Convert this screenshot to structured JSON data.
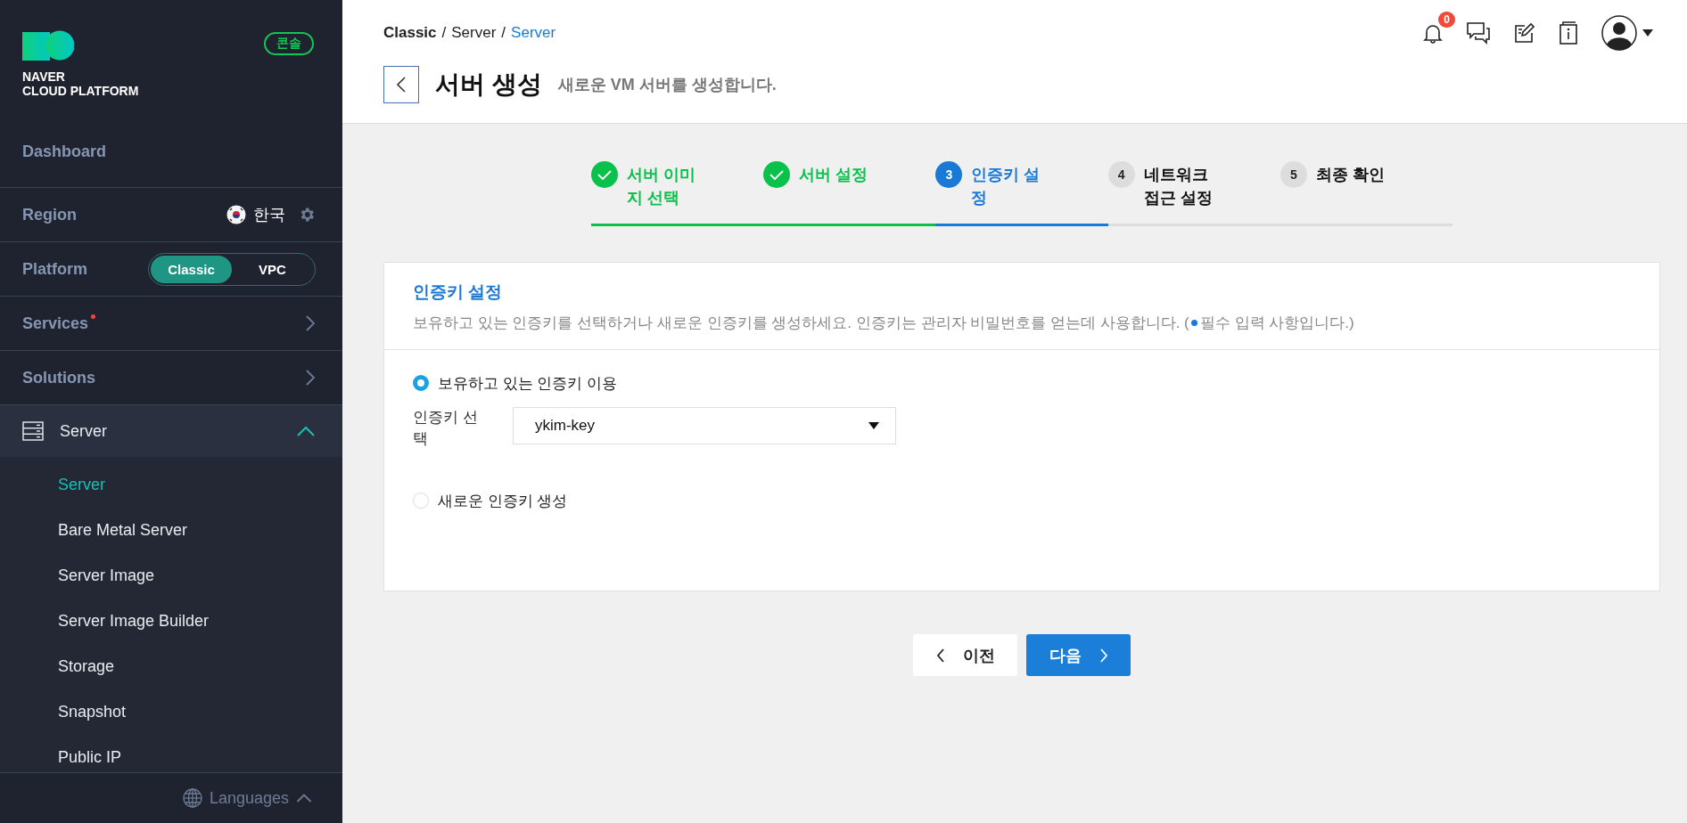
{
  "sidebar": {
    "logo": {
      "line1": "NAVER",
      "line2": "CLOUD PLATFORM"
    },
    "console_badge": "콘솔",
    "items": [
      {
        "kind": "link",
        "label": "Dashboard"
      },
      {
        "kind": "region",
        "label": "Region",
        "value": "한국"
      },
      {
        "kind": "platform",
        "label": "Platform",
        "options": [
          {
            "label": "Classic",
            "selected": true
          },
          {
            "label": "VPC",
            "selected": false
          }
        ]
      },
      {
        "kind": "menu",
        "label": "Services",
        "has_notice": true
      },
      {
        "kind": "menu",
        "label": "Solutions",
        "has_notice": false
      }
    ],
    "section": {
      "label": "Server",
      "expanded": true,
      "children": [
        {
          "label": "Server",
          "selected": true
        },
        {
          "label": "Bare Metal Server",
          "selected": false
        },
        {
          "label": "Server Image",
          "selected": false
        },
        {
          "label": "Server Image Builder",
          "selected": false
        },
        {
          "label": "Storage",
          "selected": false
        },
        {
          "label": "Snapshot",
          "selected": false
        },
        {
          "label": "Public IP",
          "selected": false
        }
      ]
    },
    "languages": "Languages"
  },
  "header": {
    "breadcrumb_separator": "/",
    "breadcrumb": [
      {
        "label": "Classic",
        "kind": "root"
      },
      {
        "label": "Server",
        "kind": "middle"
      },
      {
        "label": "Server",
        "kind": "current"
      }
    ],
    "notification_count": "0",
    "title": "서버 생성",
    "subtitle": "새로운 VM 서버를 생성합니다."
  },
  "steps": [
    {
      "label": "서버 이미지 선택",
      "completed": true,
      "current": false
    },
    {
      "label": "서버 설정",
      "completed": true,
      "current": false
    },
    {
      "number": "3",
      "label": "인증키 설정",
      "completed": false,
      "current": true
    },
    {
      "number": "4",
      "label": "네트워크 접근 설정",
      "completed": false,
      "current": false
    },
    {
      "number": "5",
      "label": "최종 확인",
      "completed": false,
      "current": false
    }
  ],
  "card": {
    "title": "인증키 설정",
    "description": "보유하고 있는 인증키를 선택하거나 새로운 인증키를 생성하세요. 인증키는 관리자 비밀번호를 얻는데 사용합니다. (",
    "required_note": "필수 입력 사항입니다.)",
    "options": [
      {
        "label": "보유하고 있는 인증키 이용",
        "selected": true
      },
      {
        "label": "새로운 인증키 생성",
        "selected": false
      }
    ],
    "key_select": {
      "label": "인증키 선택",
      "value": "ykim-key"
    }
  },
  "buttons": {
    "prev": "이전",
    "next": "다음"
  }
}
